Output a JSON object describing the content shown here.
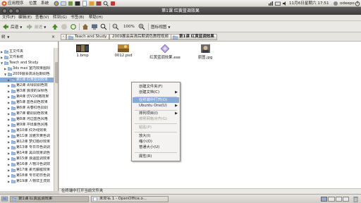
{
  "top_panel": {
    "menus": [
      "应用程序",
      "位置",
      "系统"
    ],
    "clock": "11月6日星期六 17:51",
    "user": "odeepo"
  },
  "window": {
    "title": "第1课 红黄蓝调效果"
  },
  "menubar": {
    "items": [
      "文件(F)",
      "编辑(E)",
      "查看(V)",
      "转到(G)",
      "书签(B)",
      "帮助(H)"
    ]
  },
  "toolbar": {
    "back_label": "后退",
    "forward_label": "前进",
    "zoom": "100%",
    "view_mode": "图标视图"
  },
  "locbar": {
    "crumbs": [
      "Teach and Study",
      "2009展会高清后期调色教程视频",
      "第1课 红黄蓝调效果"
    ]
  },
  "sidepane": {
    "header": "树",
    "items": [
      {
        "label": "主文件夹",
        "expanded": false,
        "level": 0
      },
      {
        "label": "文件系统",
        "expanded": false,
        "level": 0
      },
      {
        "label": "Teach and Study",
        "expanded": true,
        "level": 0
      },
      {
        "label": "3ds max 室内效果图阳",
        "expanded": false,
        "level": 1
      },
      {
        "label": "2009展会高清后期调色",
        "expanded": true,
        "level": 1
      },
      {
        "label": "第1课 红黄蓝调效果",
        "expanded": false,
        "level": 2,
        "selected": true
      },
      {
        "label": "第2课 青绿调调色效",
        "expanded": false,
        "level": 2
      },
      {
        "label": "第3课 浪漫的深秋色",
        "expanded": false,
        "level": 2
      },
      {
        "label": "第4课 仿V2风格效果",
        "expanded": false,
        "level": 2
      },
      {
        "label": "第5课 蓝色调色效果",
        "expanded": false,
        "level": 2
      },
      {
        "label": "第6课 青春红色调调",
        "expanded": false,
        "level": 2
      },
      {
        "label": "第7课 霸调调色效果",
        "expanded": false,
        "level": 2
      },
      {
        "label": "第8课 河边蓝色风格",
        "expanded": false,
        "level": 2
      },
      {
        "label": "第9课 冲出紫色风格",
        "expanded": false,
        "level": 2
      },
      {
        "label": "第10课 红外线效果",
        "expanded": false,
        "level": 2
      },
      {
        "label": "第11课 淡雅灰黄色调",
        "expanded": false,
        "level": 2
      },
      {
        "label": "第12课 梦幻婚纱效果",
        "expanded": false,
        "level": 2
      },
      {
        "label": "第13课 专日日色调调",
        "expanded": false,
        "level": 2
      },
      {
        "label": "第14课 黑白效果调色",
        "expanded": false,
        "level": 2
      },
      {
        "label": "第15课 浪温蓝调效果",
        "expanded": false,
        "level": 2
      },
      {
        "label": "第16课 人物冷色调效",
        "expanded": false,
        "level": 2
      },
      {
        "label": "第17课 柔光朦胧效果",
        "expanded": false,
        "level": 2
      },
      {
        "label": "第18课 专日初日色调",
        "expanded": false,
        "level": 2
      },
      {
        "label": "第19课 人物非主流效",
        "expanded": false,
        "level": 2
      }
    ]
  },
  "files": [
    {
      "name": "1.bmp",
      "icon": "image-thumbnail-icon"
    },
    {
      "name": "0012.psd",
      "icon": "psd-thumbnail-icon"
    },
    {
      "name": "红黄蓝调效果.exe",
      "icon": "exe-icon"
    },
    {
      "name": "原图.jpg",
      "icon": "image-thumbnail-icon"
    }
  ],
  "context_menu": {
    "items": [
      {
        "label": "创建文件夹(F)",
        "state": "normal"
      },
      {
        "label": "创建文档(C)",
        "state": "normal",
        "submenu": true
      },
      {
        "label": "在终端中打开(O)",
        "state": "highlighted"
      },
      {
        "label": "Ubuntu One(U)",
        "state": "normal",
        "submenu": true
      },
      {
        "label": "排列项目(I)",
        "state": "normal",
        "submenu": true
      },
      {
        "label": "按照网格对齐(G)",
        "state": "disabled"
      },
      {
        "label": "粘贴(P)",
        "state": "disabled"
      },
      {
        "label": "放大(I)",
        "state": "normal"
      },
      {
        "label": "缩小(O)",
        "state": "normal"
      },
      {
        "label": "普通大小(U)",
        "state": "normal"
      },
      {
        "label": "属性(R)",
        "state": "normal"
      }
    ]
  },
  "statusbar": {
    "text": "在终端中打开当前文件夹"
  },
  "taskbar": {
    "items": [
      {
        "label": "第1课 红黄蓝调效果",
        "active": true
      },
      {
        "label": "未命名 1 - OpenOffice.o...",
        "active": false
      }
    ]
  },
  "colors": {
    "selection": "#86abd9",
    "titlebar": "#4a4a4a",
    "folder": "#9fbcdf"
  }
}
